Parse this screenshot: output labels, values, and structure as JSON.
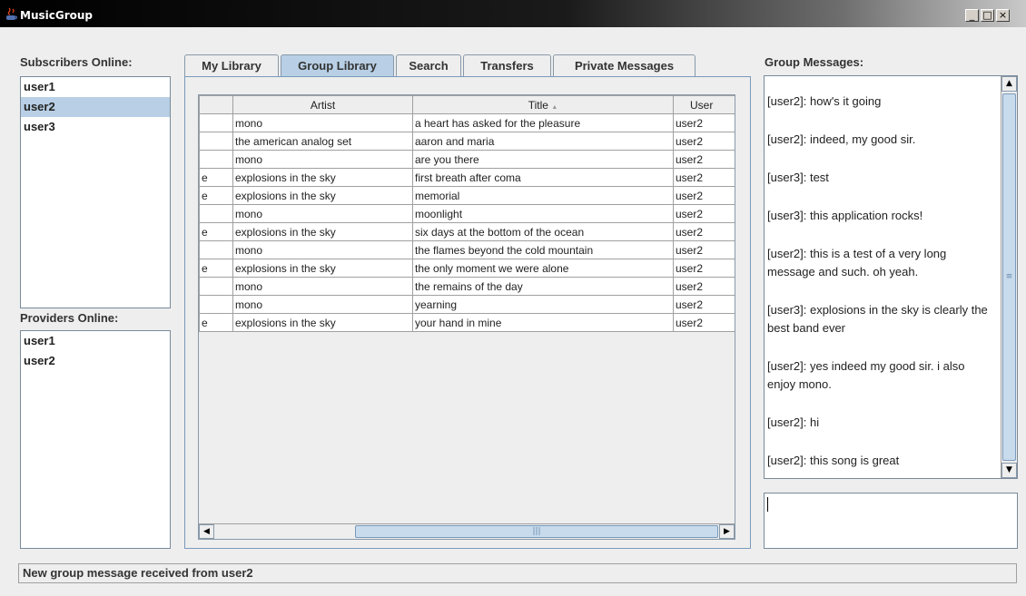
{
  "window": {
    "title": "MusicGroup",
    "buttons": [
      "_",
      "□",
      "×"
    ]
  },
  "subscribers": {
    "label": "Subscribers Online:",
    "items": [
      "user1",
      "user2",
      "user3"
    ],
    "selected_index": 1
  },
  "providers": {
    "label": "Providers Online:",
    "items": [
      "user1",
      "user2"
    ]
  },
  "tabs": [
    {
      "label": "My Library",
      "active": false
    },
    {
      "label": "Group Library",
      "active": true
    },
    {
      "label": "Search",
      "active": false
    },
    {
      "label": "Transfers",
      "active": false
    },
    {
      "label": "Private Messages",
      "active": false
    }
  ],
  "table": {
    "columns": [
      "",
      "Artist",
      "Title",
      "User"
    ],
    "sort_indicator": "▲",
    "rows": [
      [
        "",
        "mono",
        "a heart has asked for the pleasure",
        "user2"
      ],
      [
        "",
        "the american analog set",
        "aaron and maria",
        "user2"
      ],
      [
        "",
        "mono",
        "are you there",
        "user2"
      ],
      [
        "e",
        "explosions in the sky",
        "first breath after coma",
        "user2"
      ],
      [
        "e",
        "explosions in the sky",
        "memorial",
        "user2"
      ],
      [
        "",
        "mono",
        "moonlight",
        "user2"
      ],
      [
        "e",
        "explosions in the sky",
        "six days at the bottom of the ocean",
        "user2"
      ],
      [
        "",
        "mono",
        "the flames beyond the cold mountain",
        "user2"
      ],
      [
        "e",
        "explosions in the sky",
        "the only moment we were alone",
        "user2"
      ],
      [
        "",
        "mono",
        "the remains of the day",
        "user2"
      ],
      [
        "",
        "mono",
        "yearning",
        "user2"
      ],
      [
        "e",
        "explosions in the sky",
        "your hand in mine",
        "user2"
      ]
    ]
  },
  "group_messages": {
    "label": "Group Messages:",
    "messages": [
      "[user2]: how's it going",
      "[user2]: indeed, my good sir.",
      "[user3]: test",
      "[user3]: this application rocks!",
      "[user2]: this is a test of a very long message and such.  oh yeah.",
      "[user3]: explosions in the sky is clearly the best band ever",
      "[user2]: yes indeed my good sir.  i also enjoy mono.",
      "[user2]: hi",
      "[user2]: this song is great"
    ],
    "input_value": ""
  },
  "status": {
    "text": "New group message received from user2"
  },
  "colors": {
    "selection": "#b8cfe5",
    "accent": "#7a9abb",
    "background": "#eeeeee"
  }
}
